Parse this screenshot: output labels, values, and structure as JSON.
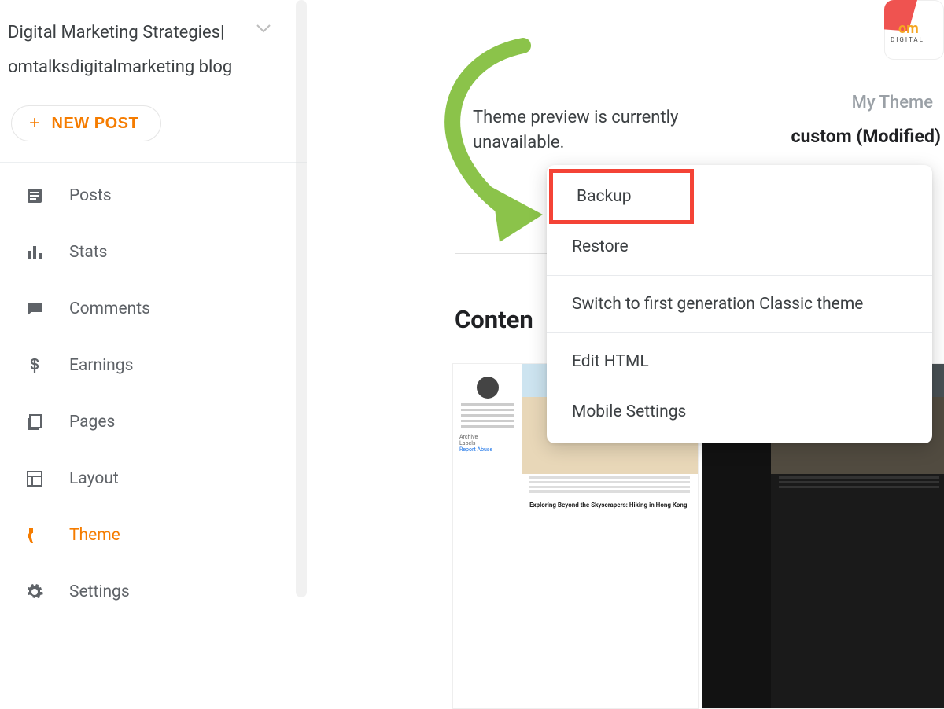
{
  "blog": {
    "title": "Digital Marketing Strategies| omtalksdigitalmarketing blog"
  },
  "sidebar": {
    "new_post_label": "NEW POST",
    "items": [
      {
        "label": "Posts",
        "icon": "posts"
      },
      {
        "label": "Stats",
        "icon": "stats"
      },
      {
        "label": "Comments",
        "icon": "comments"
      },
      {
        "label": "Earnings",
        "icon": "earnings"
      },
      {
        "label": "Pages",
        "icon": "pages"
      },
      {
        "label": "Layout",
        "icon": "layout"
      },
      {
        "label": "Theme",
        "icon": "theme",
        "active": true
      },
      {
        "label": "Settings",
        "icon": "settings"
      }
    ]
  },
  "main": {
    "preview_unavailable": "Theme preview is currently unavailable.",
    "my_theme_label": "My Theme",
    "my_theme_value": "custom (Modified)",
    "section_heading_partial": "Conten",
    "menu": {
      "items": [
        {
          "label": "Backup",
          "highlighted": true
        },
        {
          "label": "Restore"
        },
        {
          "label": "Switch to first generation Classic theme"
        },
        {
          "label": "Edit HTML"
        },
        {
          "label": "Mobile Settings"
        }
      ]
    },
    "thumb_sidebar": {
      "archive_label": "Archive",
      "labels_label": "Labels",
      "report_label": "Report Abuse"
    },
    "thumb_post_title": "Exploring Beyond the Skyscrapers: Hiking in Hong Kong"
  },
  "brand": {
    "mark": "om",
    "sub": "DIGITAL"
  }
}
